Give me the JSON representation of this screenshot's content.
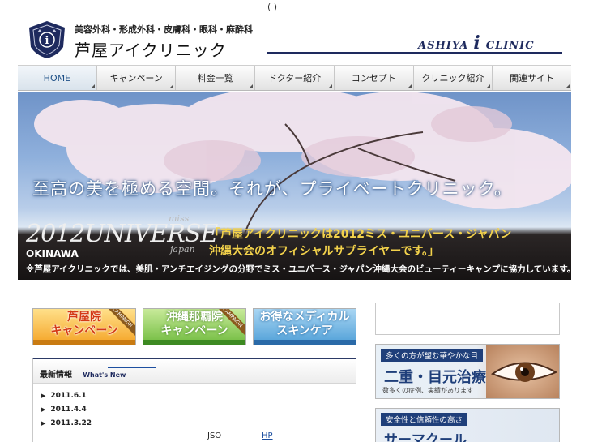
{
  "top": {
    "paren": "( )"
  },
  "header": {
    "subtitle": "美容外科・形成外科・皮膚科・眼科・麻酔科",
    "clinic_name": "芦屋アイクリニック",
    "brand_left": "ASHIYA",
    "brand_i": "i",
    "brand_right": "CLINIC",
    "brand_color": "#1e2a5e"
  },
  "nav": {
    "items": [
      {
        "label": "HOME"
      },
      {
        "label": "キャンペーン"
      },
      {
        "label": "料金一覧"
      },
      {
        "label": "ドクター紹介"
      },
      {
        "label": "コンセプト"
      },
      {
        "label": "クリニック紹介"
      },
      {
        "label": "関連サイト"
      }
    ]
  },
  "hero": {
    "headline": "至高の美を極める空間。それが、プライベートクリニック。",
    "miss_small": "miss",
    "miss_year_title": "2012UNIVERSE",
    "miss_japan": "japan",
    "miss_region": "OKINAWA",
    "quote_line1": "「芦屋アイクリニックは2012ミス・ユニバース・ジャパン",
    "quote_line2": "沖縄大会のオフィシャルサプライヤーです。」",
    "note": "※芦屋アイクリニックでは、美肌・アンチエイジングの分野でミス・ユニバース・ジャパン沖縄大会のビューティーキャンプに協力しています。",
    "quote_color": "#f3d24b"
  },
  "campaigns": [
    {
      "line1": "芦屋院",
      "line2": "キャンペーン",
      "ribbon": "CAMPAIGN"
    },
    {
      "line1": "沖縄那覇院",
      "line2": "キャンペーン",
      "ribbon": "CAMPAIGN"
    },
    {
      "line1": "お得なメディカル",
      "line2": "スキンケア"
    }
  ],
  "news": {
    "title": "最新情報",
    "subtitle": "What's New",
    "items": [
      {
        "date": "2011.6.1"
      },
      {
        "date": "2011.4.4"
      },
      {
        "date": "2011.3.22"
      }
    ],
    "json_text": "JSO",
    "hp_text": "HP"
  },
  "side": {
    "eye_banner": {
      "tag": "多くの方が望む華やかな目",
      "title": "二重・目元治療",
      "caption": "数多くの症例、実績があります"
    },
    "therma_banner": {
      "tag": "安全性と信頼性の高さ",
      "title": "サーマクール"
    }
  }
}
